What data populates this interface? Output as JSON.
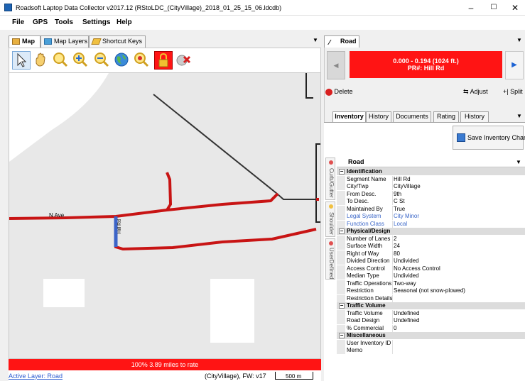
{
  "window": {
    "title": "Roadsoft Laptop Data Collector v2017.12 (RStoLDC_(CityVillage)_2018_01_25_15_06.ldcdb)",
    "minimize": "–",
    "maximize": "☐",
    "close": "✕"
  },
  "menu": [
    "File",
    "GPS",
    "Tools",
    "Settings",
    "Help"
  ],
  "left_tabs": [
    "Map",
    "Map Layers",
    "Shortcut Keys"
  ],
  "toolbar": {
    "tools": [
      "select-arrow-icon",
      "pan-hand-icon",
      "zoom-in-icon",
      "zoom-in-plus-icon",
      "zoom-out-icon",
      "globe-icon",
      "zoom-extent-icon",
      "lock-icon",
      "clear-selection-icon"
    ]
  },
  "map": {
    "road_labels": [
      "N Ave",
      "Hill Rd"
    ],
    "status_bar": "100% 3.89 miles to rate",
    "active_layer_link": "Active Layer: Road",
    "footer_info": "(CityVillage), FW: v17",
    "scale_label": "500 m"
  },
  "right_tab": "Road",
  "nav": {
    "range": "0.000 - 0.194 (1024 ft.)",
    "pr": "PR#: Hill Rd",
    "prev": "◀",
    "next": "▶"
  },
  "actions": {
    "delete": "Delete",
    "adjust": "Adjust",
    "split": "Split"
  },
  "inventory_tabs": [
    "Inventory",
    "History",
    "Documents",
    "Rating",
    "History"
  ],
  "save_inventory": "Save Inventory Changes",
  "side_tabs": [
    "Curb/Gutter",
    "Shoulder",
    "UserDefined"
  ],
  "grid": {
    "header": "Road",
    "rows": [
      {
        "cat": true,
        "k": "Identification"
      },
      {
        "k": "Segment Name",
        "v": "Hill Rd"
      },
      {
        "k": "City/Twp",
        "v": "CityVillage"
      },
      {
        "k": "From Desc.",
        "v": "9th"
      },
      {
        "k": "To Desc.",
        "v": "C St"
      },
      {
        "k": "Maintained By",
        "v": "True"
      },
      {
        "k": "Legal System",
        "v": "City Minor",
        "link": true
      },
      {
        "k": "Function Class",
        "v": "Local",
        "link": true
      },
      {
        "cat": true,
        "k": "Physical/Design"
      },
      {
        "k": "Number of Lanes",
        "v": "2"
      },
      {
        "k": "Surface Width",
        "v": "24"
      },
      {
        "k": "Right of Way",
        "v": "80"
      },
      {
        "k": "Divided Direction",
        "v": "Undivided"
      },
      {
        "k": "Access Control",
        "v": "No Access Control"
      },
      {
        "k": "Median Type",
        "v": "Undivided"
      },
      {
        "k": "Traffic Operations",
        "v": "Two-way"
      },
      {
        "k": "Restriction",
        "v": "Seasonal (not snow-plowed)"
      },
      {
        "k": "Restriction Details",
        "v": ""
      },
      {
        "cat": true,
        "k": "Traffic Volume"
      },
      {
        "k": "Traffic Volume",
        "v": "Undefined"
      },
      {
        "k": "Road Design",
        "v": "Undefined"
      },
      {
        "k": "% Commercial",
        "v": "0"
      },
      {
        "cat": true,
        "k": "Miscellaneous"
      },
      {
        "k": "User Inventory ID",
        "v": ""
      },
      {
        "k": "Memo",
        "v": ""
      }
    ]
  },
  "colors": {
    "accent_red": "#ff1414",
    "road_red": "#c81414",
    "selected_blue": "#3c64c8",
    "link_blue": "#3a66c8"
  }
}
